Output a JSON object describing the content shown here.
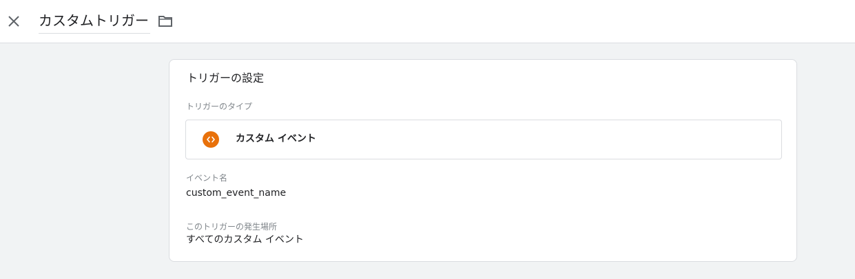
{
  "header": {
    "title": "カスタムトリガー",
    "close_icon": "close-icon",
    "folder_icon": "folder-icon"
  },
  "trigger_config": {
    "section_title": "トリガーの設定",
    "type_label": "トリガーのタイプ",
    "type_value": "カスタム イベント",
    "type_icon": "code-brackets-icon",
    "type_icon_color": "#e8710a",
    "event_name_label": "イベント名",
    "event_name_value": "custom_event_name",
    "fires_on_label": "このトリガーの発生場所",
    "fires_on_value": "すべてのカスタム イベント"
  }
}
